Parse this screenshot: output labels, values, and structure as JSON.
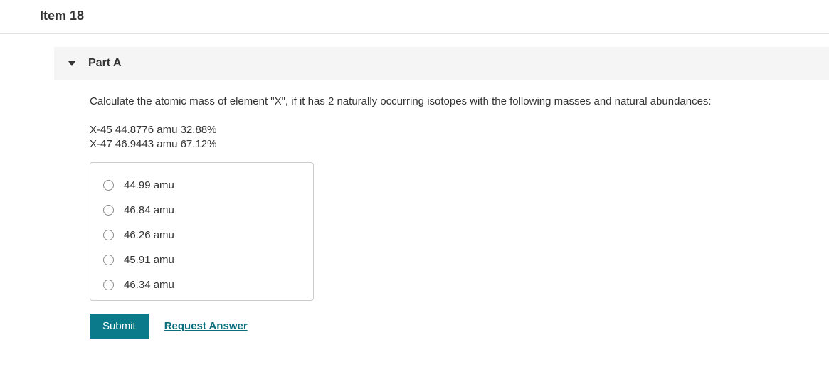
{
  "item": {
    "title": "Item 18"
  },
  "part": {
    "title": "Part A"
  },
  "question": {
    "prompt": "Calculate the atomic mass of element \"X\", if it has 2 naturally occurring isotopes with the following masses and natural abundances:",
    "data_line1": "X-45 44.8776 amu 32.88%",
    "data_line2": "X-47 46.9443 amu 67.12%"
  },
  "options": [
    {
      "label": "44.99 amu"
    },
    {
      "label": "46.84 amu"
    },
    {
      "label": "46.26 amu"
    },
    {
      "label": "45.91 amu"
    },
    {
      "label": "46.34 amu"
    }
  ],
  "actions": {
    "submit": "Submit",
    "request": "Request Answer"
  }
}
